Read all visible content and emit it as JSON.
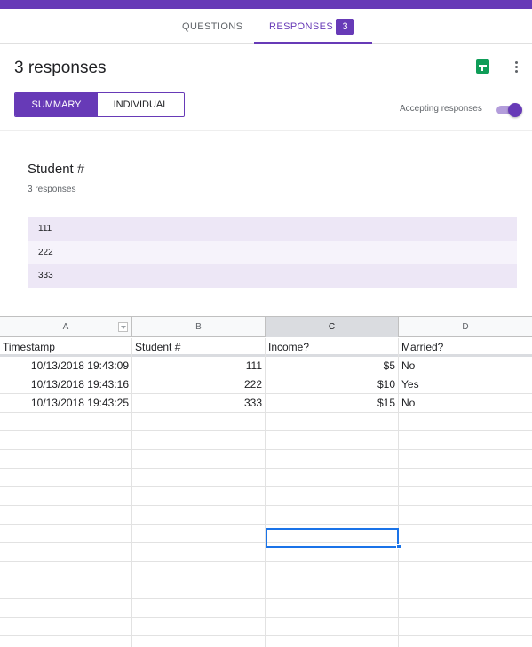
{
  "tabs": {
    "questions": "QUESTIONS",
    "responses": "RESPONSES",
    "responses_count": "3"
  },
  "header": {
    "title": "3 responses",
    "summary_label": "SUMMARY",
    "individual_label": "INDIVIDUAL",
    "accepting_label": "Accepting responses",
    "accepting_on": true,
    "sheets_icon": "google-sheets-icon",
    "more_icon": "more-vert-icon"
  },
  "question": {
    "title": "Student #",
    "count": "3 responses",
    "answers": [
      "111",
      "222",
      "333"
    ]
  },
  "sheet": {
    "columns": [
      "A",
      "B",
      "C",
      "D"
    ],
    "selected_column": "C",
    "header": [
      "Timestamp",
      "Student #",
      "Income?",
      "Married?"
    ],
    "rows": [
      [
        "10/13/2018 19:43:09",
        "111",
        "$5",
        "No"
      ],
      [
        "10/13/2018 19:43:16",
        "222",
        "$10",
        "Yes"
      ],
      [
        "10/13/2018 19:43:25",
        "333",
        "$15",
        "No"
      ]
    ]
  },
  "colors": {
    "accent": "#673ab7",
    "sheets_green": "#0f9d58",
    "selection_blue": "#1a73e8"
  }
}
